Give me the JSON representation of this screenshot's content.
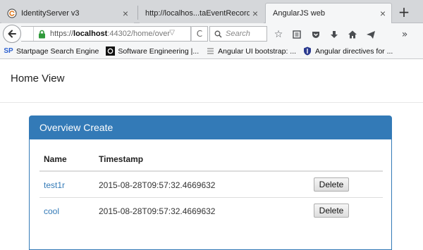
{
  "browser": {
    "tabs": [
      {
        "title": "IdentityServer v3",
        "active": false
      },
      {
        "title": "http://localhos...taEventRecords",
        "active": false
      },
      {
        "title": "AngularJS web",
        "active": true
      }
    ],
    "new_tab": "+",
    "close_glyph": "×",
    "address": {
      "scheme": "https://",
      "host": "localhost",
      "port_path": ":44302/home/over"
    },
    "search_placeholder": "Search",
    "toolbar_icons": [
      "star-icon",
      "reading-list-icon",
      "pocket-icon",
      "download-icon",
      "home-icon",
      "share-icon",
      "overflow-icon"
    ],
    "overflow": "»"
  },
  "bookmarks": [
    {
      "label": "Startpage Search Engine",
      "icon": "startpage-icon",
      "icon_text": "SP"
    },
    {
      "label": "Software Engineering |...",
      "icon": "blog-icon"
    },
    {
      "label": "Angular UI bootstrap: ...",
      "icon": "bootstrap-icon"
    },
    {
      "label": "Angular directives for ...",
      "icon": "shield-icon"
    }
  ],
  "page": {
    "header_title": "Home View",
    "panel": {
      "title": "Overview Create",
      "columns": [
        "Name",
        "Timestamp"
      ],
      "rows": [
        {
          "name": "test1r",
          "timestamp": "2015-08-28T09:57:32.4669632",
          "action": "Delete"
        },
        {
          "name": "cool",
          "timestamp": "2015-08-28T09:57:32.4669632",
          "action": "Delete"
        }
      ]
    }
  },
  "colors": {
    "primary": "#337ab7",
    "tabbar": "#d5d7da",
    "chrome": "#f5f6f7"
  }
}
